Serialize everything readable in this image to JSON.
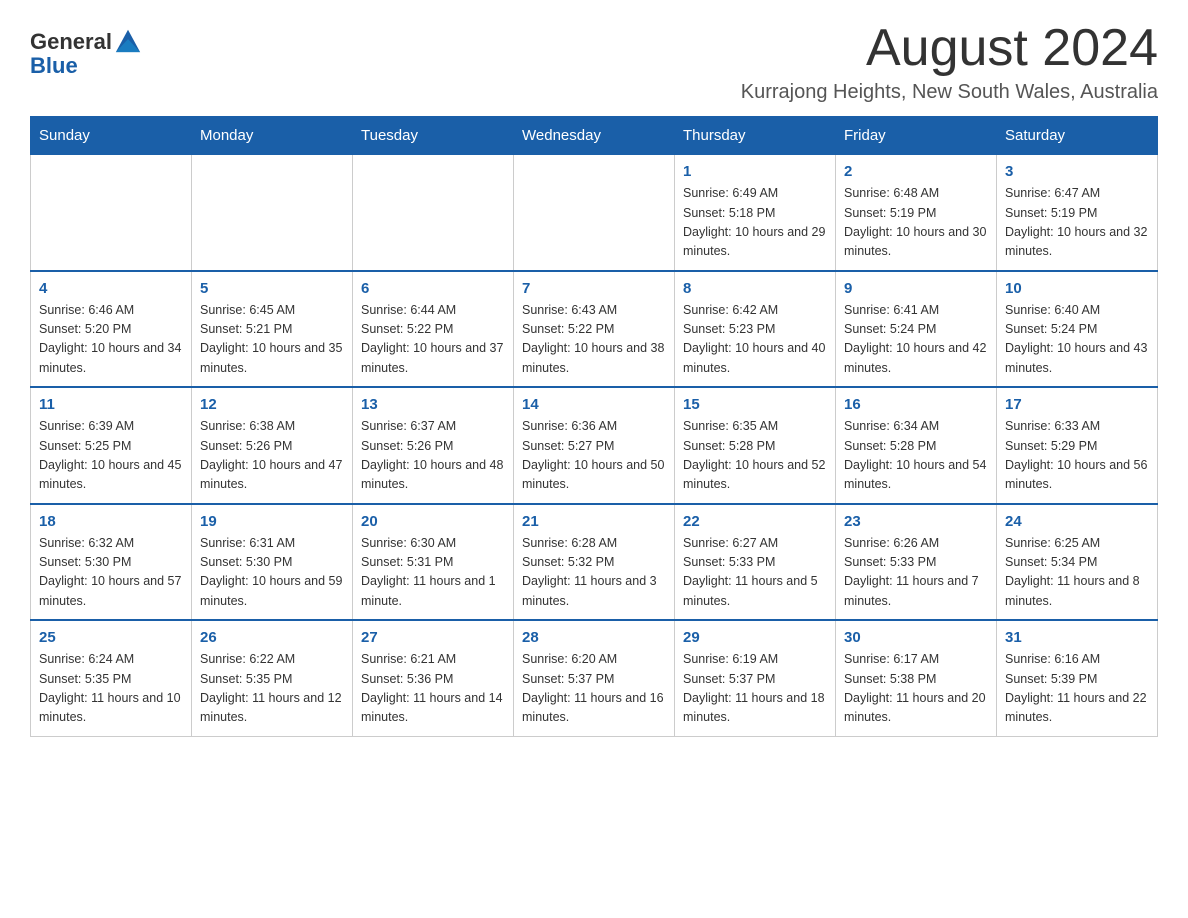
{
  "header": {
    "logo_general": "General",
    "logo_blue": "Blue",
    "month_title": "August 2024",
    "location": "Kurrajong Heights, New South Wales, Australia"
  },
  "weekdays": [
    "Sunday",
    "Monday",
    "Tuesday",
    "Wednesday",
    "Thursday",
    "Friday",
    "Saturday"
  ],
  "weeks": [
    [
      {
        "day": "",
        "info": ""
      },
      {
        "day": "",
        "info": ""
      },
      {
        "day": "",
        "info": ""
      },
      {
        "day": "",
        "info": ""
      },
      {
        "day": "1",
        "info": "Sunrise: 6:49 AM\nSunset: 5:18 PM\nDaylight: 10 hours and 29 minutes."
      },
      {
        "day": "2",
        "info": "Sunrise: 6:48 AM\nSunset: 5:19 PM\nDaylight: 10 hours and 30 minutes."
      },
      {
        "day": "3",
        "info": "Sunrise: 6:47 AM\nSunset: 5:19 PM\nDaylight: 10 hours and 32 minutes."
      }
    ],
    [
      {
        "day": "4",
        "info": "Sunrise: 6:46 AM\nSunset: 5:20 PM\nDaylight: 10 hours and 34 minutes."
      },
      {
        "day": "5",
        "info": "Sunrise: 6:45 AM\nSunset: 5:21 PM\nDaylight: 10 hours and 35 minutes."
      },
      {
        "day": "6",
        "info": "Sunrise: 6:44 AM\nSunset: 5:22 PM\nDaylight: 10 hours and 37 minutes."
      },
      {
        "day": "7",
        "info": "Sunrise: 6:43 AM\nSunset: 5:22 PM\nDaylight: 10 hours and 38 minutes."
      },
      {
        "day": "8",
        "info": "Sunrise: 6:42 AM\nSunset: 5:23 PM\nDaylight: 10 hours and 40 minutes."
      },
      {
        "day": "9",
        "info": "Sunrise: 6:41 AM\nSunset: 5:24 PM\nDaylight: 10 hours and 42 minutes."
      },
      {
        "day": "10",
        "info": "Sunrise: 6:40 AM\nSunset: 5:24 PM\nDaylight: 10 hours and 43 minutes."
      }
    ],
    [
      {
        "day": "11",
        "info": "Sunrise: 6:39 AM\nSunset: 5:25 PM\nDaylight: 10 hours and 45 minutes."
      },
      {
        "day": "12",
        "info": "Sunrise: 6:38 AM\nSunset: 5:26 PM\nDaylight: 10 hours and 47 minutes."
      },
      {
        "day": "13",
        "info": "Sunrise: 6:37 AM\nSunset: 5:26 PM\nDaylight: 10 hours and 48 minutes."
      },
      {
        "day": "14",
        "info": "Sunrise: 6:36 AM\nSunset: 5:27 PM\nDaylight: 10 hours and 50 minutes."
      },
      {
        "day": "15",
        "info": "Sunrise: 6:35 AM\nSunset: 5:28 PM\nDaylight: 10 hours and 52 minutes."
      },
      {
        "day": "16",
        "info": "Sunrise: 6:34 AM\nSunset: 5:28 PM\nDaylight: 10 hours and 54 minutes."
      },
      {
        "day": "17",
        "info": "Sunrise: 6:33 AM\nSunset: 5:29 PM\nDaylight: 10 hours and 56 minutes."
      }
    ],
    [
      {
        "day": "18",
        "info": "Sunrise: 6:32 AM\nSunset: 5:30 PM\nDaylight: 10 hours and 57 minutes."
      },
      {
        "day": "19",
        "info": "Sunrise: 6:31 AM\nSunset: 5:30 PM\nDaylight: 10 hours and 59 minutes."
      },
      {
        "day": "20",
        "info": "Sunrise: 6:30 AM\nSunset: 5:31 PM\nDaylight: 11 hours and 1 minute."
      },
      {
        "day": "21",
        "info": "Sunrise: 6:28 AM\nSunset: 5:32 PM\nDaylight: 11 hours and 3 minutes."
      },
      {
        "day": "22",
        "info": "Sunrise: 6:27 AM\nSunset: 5:33 PM\nDaylight: 11 hours and 5 minutes."
      },
      {
        "day": "23",
        "info": "Sunrise: 6:26 AM\nSunset: 5:33 PM\nDaylight: 11 hours and 7 minutes."
      },
      {
        "day": "24",
        "info": "Sunrise: 6:25 AM\nSunset: 5:34 PM\nDaylight: 11 hours and 8 minutes."
      }
    ],
    [
      {
        "day": "25",
        "info": "Sunrise: 6:24 AM\nSunset: 5:35 PM\nDaylight: 11 hours and 10 minutes."
      },
      {
        "day": "26",
        "info": "Sunrise: 6:22 AM\nSunset: 5:35 PM\nDaylight: 11 hours and 12 minutes."
      },
      {
        "day": "27",
        "info": "Sunrise: 6:21 AM\nSunset: 5:36 PM\nDaylight: 11 hours and 14 minutes."
      },
      {
        "day": "28",
        "info": "Sunrise: 6:20 AM\nSunset: 5:37 PM\nDaylight: 11 hours and 16 minutes."
      },
      {
        "day": "29",
        "info": "Sunrise: 6:19 AM\nSunset: 5:37 PM\nDaylight: 11 hours and 18 minutes."
      },
      {
        "day": "30",
        "info": "Sunrise: 6:17 AM\nSunset: 5:38 PM\nDaylight: 11 hours and 20 minutes."
      },
      {
        "day": "31",
        "info": "Sunrise: 6:16 AM\nSunset: 5:39 PM\nDaylight: 11 hours and 22 minutes."
      }
    ]
  ]
}
